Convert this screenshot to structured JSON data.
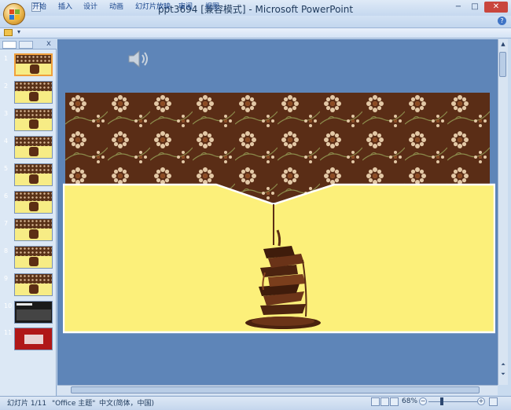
{
  "window": {
    "title": "ppt3694 [兼容模式] - Microsoft PowerPoint",
    "minimize": "−",
    "maximize": "□",
    "close": "✕"
  },
  "ribbon": {
    "tabs": [
      "开始",
      "插入",
      "设计",
      "动画",
      "幻灯片放映",
      "审阅",
      "视图"
    ],
    "help": "?"
  },
  "thumbnails": {
    "numbers": [
      "1",
      "2",
      "3",
      "4",
      "5",
      "6",
      "7",
      "8",
      "9",
      "10",
      "11"
    ],
    "selected": 1,
    "close": "x"
  },
  "status": {
    "slide": "幻灯片 1/11",
    "theme": "\"Office 主题\"",
    "language": "中文(简体，中国)",
    "zoom": "68%",
    "zoom_level": 0.68
  },
  "colors": {
    "slide_yellow": "#fcf07a",
    "slide_brown": "#5a2d16",
    "canvas_blue": "#5e85b8"
  }
}
